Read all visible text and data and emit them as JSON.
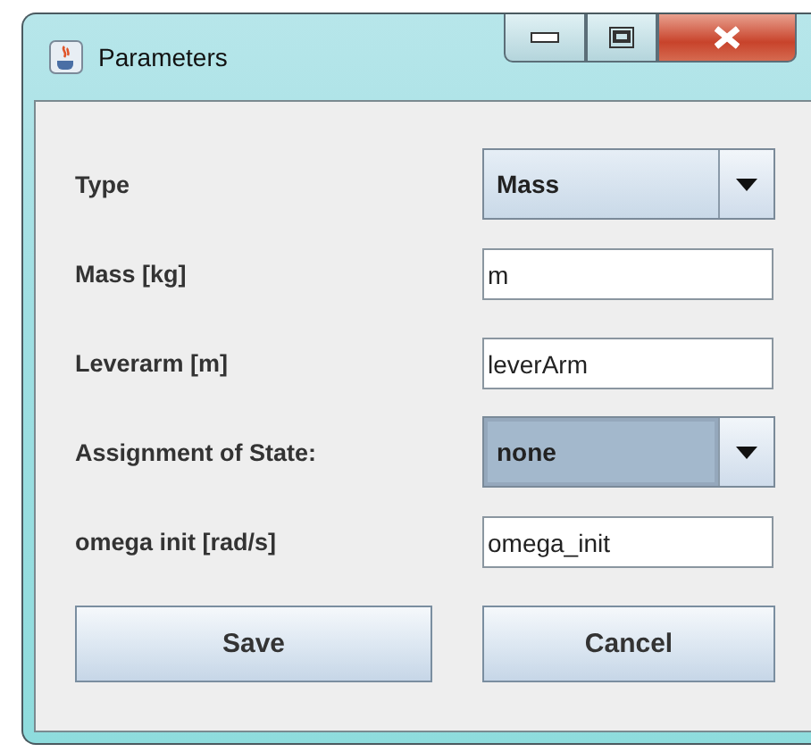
{
  "window": {
    "title": "Parameters"
  },
  "fields": [
    {
      "label": "Type",
      "kind": "combo",
      "value": "Mass",
      "focused": false
    },
    {
      "label": "Mass [kg]",
      "kind": "text",
      "value": "m"
    },
    {
      "label": "Leverarm [m]",
      "kind": "text",
      "value": "leverArm"
    },
    {
      "label": "Assignment of State:",
      "kind": "combo",
      "value": "none",
      "focused": true
    },
    {
      "label": "omega init [rad/s]",
      "kind": "text",
      "value": "omega_init"
    }
  ],
  "buttons": [
    "Save",
    "Cancel"
  ]
}
